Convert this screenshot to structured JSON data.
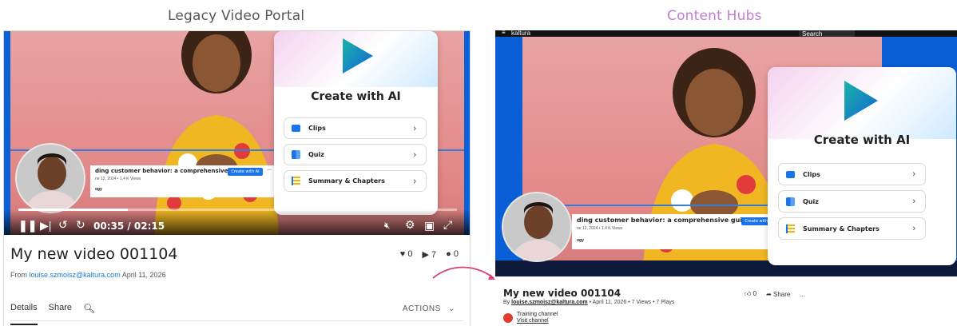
{
  "headings": {
    "left": "Legacy Video Portal",
    "right": "Content Hubs"
  },
  "ai_card": {
    "title": "Create with AI",
    "items": [
      {
        "label": "Clips",
        "icon": "clips-icon"
      },
      {
        "label": "Quiz",
        "icon": "quiz-icon"
      },
      {
        "label": "Summary & Chapters",
        "icon": "summary-icon"
      }
    ]
  },
  "embedded_video_card": {
    "title": "ding customer behavior: a comprehensive guide",
    "meta": "ne 12, 2024  •  1.4 K Views",
    "sub": "ogy",
    "button": "Create with AI",
    "more": "..."
  },
  "embedded_video_card_right": {
    "title": "ding customer behavior: a comprehensive guide",
    "meta": "ne 12, 2024  •  1.4 K Views",
    "sub": "ogy",
    "button": "Create with AI",
    "more": "..."
  },
  "legacy": {
    "player": {
      "time": "00:35 / 02:15",
      "progress": 0.25,
      "controls": [
        "pause",
        "next",
        "rewind 10",
        "forward 10",
        "mute",
        "settings",
        "picture-in-picture",
        "fullscreen"
      ]
    },
    "video_title": "My new video 001104",
    "stats": {
      "likes": "0",
      "plays": "7",
      "comments": "0"
    },
    "from_prefix": "From",
    "from_user": "louise.szmoisz@kaltura.com",
    "from_date": "April 11, 2026",
    "tabs": [
      "Details",
      "Share"
    ],
    "actions_label": "ACTIONS"
  },
  "hub": {
    "top_bar": {
      "brand": "kaltura",
      "search_placeholder": "Search"
    },
    "video_title": "My new video 001104",
    "meta": {
      "by": "By",
      "user": "louise.szmoisz@kaltura.com",
      "date": "April 11, 2026",
      "views": "7 Views",
      "plays": "7 Plays"
    },
    "like_count": "0",
    "share_label": "Share",
    "more_label": "...",
    "channel": {
      "name": "Training channel",
      "link": "Visit channel"
    }
  },
  "colors": {
    "player_blue": "#0a60d8",
    "accent_pink": "#c57bd3",
    "link_blue": "#1a7bd1",
    "channel_red": "#e03e2d"
  }
}
